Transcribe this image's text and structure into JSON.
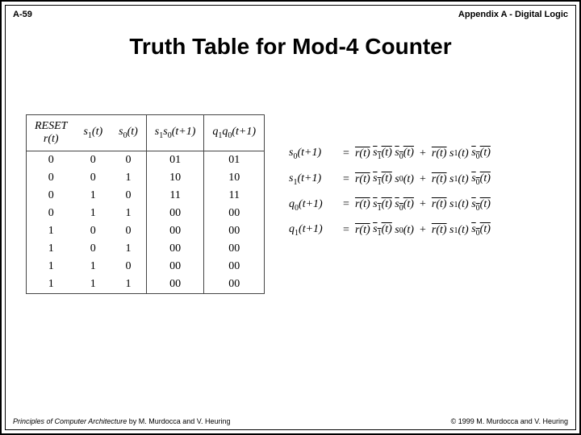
{
  "header": {
    "page_ref": "A-59",
    "section": "Appendix A - Digital Logic"
  },
  "title": "Truth Table for Mod-4 Counter",
  "table": {
    "headers": {
      "reset_label": "RESET",
      "r": "r(t)",
      "s1": "s",
      "s1_sub": "1",
      "s1_arg": "(t)",
      "s0": "s",
      "s0_sub": "0",
      "s0_arg": "(t)",
      "ns": "s",
      "ns1_sub": "1",
      "ns0": "s",
      "ns0_sub": "0",
      "ns_arg": "(t+1)",
      "q": "q",
      "q1_sub": "1",
      "q0": "q",
      "q0_sub": "0",
      "q_arg": "(t+1)"
    },
    "rows": [
      {
        "r": "0",
        "s1": "0",
        "s0": "0",
        "ns": "01",
        "q": "01"
      },
      {
        "r": "0",
        "s1": "0",
        "s0": "1",
        "ns": "10",
        "q": "10"
      },
      {
        "r": "0",
        "s1": "1",
        "s0": "0",
        "ns": "11",
        "q": "11"
      },
      {
        "r": "0",
        "s1": "1",
        "s0": "1",
        "ns": "00",
        "q": "00"
      },
      {
        "r": "1",
        "s1": "0",
        "s0": "0",
        "ns": "00",
        "q": "00"
      },
      {
        "r": "1",
        "s1": "0",
        "s0": "1",
        "ns": "00",
        "q": "00"
      },
      {
        "r": "1",
        "s1": "1",
        "s0": "0",
        "ns": "00",
        "q": "00"
      },
      {
        "r": "1",
        "s1": "1",
        "s0": "1",
        "ns": "00",
        "q": "00"
      }
    ]
  },
  "equations": {
    "eq": "=",
    "plus": "+",
    "lines": [
      {
        "lhs_var": "s",
        "lhs_sub": "0",
        "lhs_arg": "(t+1)"
      },
      {
        "lhs_var": "s",
        "lhs_sub": "1",
        "lhs_arg": "(t+1)"
      },
      {
        "lhs_var": "q",
        "lhs_sub": "0",
        "lhs_arg": "(t+1)"
      },
      {
        "lhs_var": "q",
        "lhs_sub": "1",
        "lhs_arg": "(t+1)"
      }
    ],
    "term": {
      "r": "r(t)",
      "s": "s",
      "sub1": "1",
      "sub0": "0",
      "arg": "(t)"
    }
  },
  "footer": {
    "book_title": "Principles of Computer Architecture",
    "authors": " by M. Murdocca and V. Heuring",
    "copyright": "© 1999 M. Murdocca and V. Heuring"
  }
}
